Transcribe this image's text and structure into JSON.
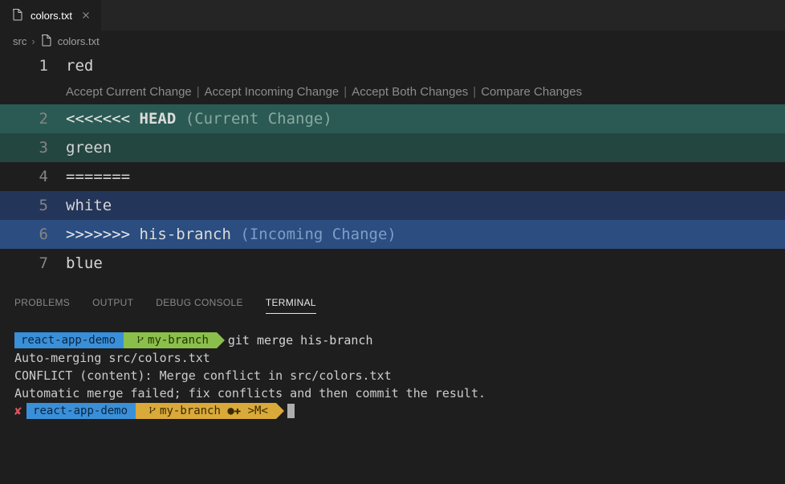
{
  "tab": {
    "filename": "colors.txt"
  },
  "breadcrumb": {
    "folder": "src",
    "file": "colors.txt"
  },
  "codelens": {
    "accept_current": "Accept Current Change",
    "accept_incoming": "Accept Incoming Change",
    "accept_both": "Accept Both Changes",
    "compare": "Compare Changes"
  },
  "editor": {
    "lines": {
      "1": {
        "num": "1",
        "text": "red"
      },
      "2": {
        "num": "2",
        "markers": "<<<<<<<",
        "head": "HEAD",
        "note": "(Current Change)"
      },
      "3": {
        "num": "3",
        "text": "green"
      },
      "4": {
        "num": "4",
        "text": "======="
      },
      "5": {
        "num": "5",
        "text": "white"
      },
      "6": {
        "num": "6",
        "markers": ">>>>>>>",
        "branch": "his-branch",
        "note": "(Incoming Change)"
      },
      "7": {
        "num": "7",
        "text": "blue"
      }
    }
  },
  "panel_tabs": {
    "problems": "PROBLEMS",
    "output": "OUTPUT",
    "debug": "DEBUG CONSOLE",
    "terminal": "TERMINAL"
  },
  "terminal": {
    "prompt1": {
      "project": "react-app-demo",
      "branch": "my-branch",
      "command": "git merge his-branch"
    },
    "out1": "Auto-merging src/colors.txt",
    "out2": "CONFLICT (content): Merge conflict in src/colors.txt",
    "out3": "Automatic merge failed; fix conflicts and then commit the result.",
    "prompt2": {
      "status": "✘",
      "project": "react-app-demo",
      "branch_status": "my-branch ●✚ >M<"
    }
  }
}
